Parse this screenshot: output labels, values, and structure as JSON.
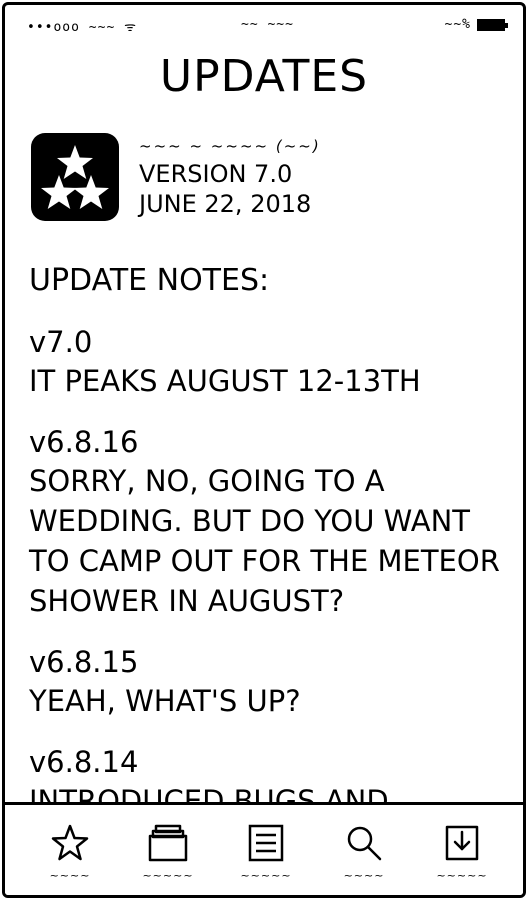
{
  "status_bar": {
    "carrier": "•••ooo ~~~ ᯤ",
    "time": "~~ ~~~",
    "battery_percent": "~~%"
  },
  "page": {
    "title": "UPDATES"
  },
  "app": {
    "name": "~~~ ~ ~~~~ (~~)",
    "version": "VERSION 7.0",
    "date": "JUNE 22, 2018",
    "icon": "three-stars-icon"
  },
  "notes": {
    "heading": "UPDATE NOTES:",
    "entries": [
      {
        "version": "v7.0",
        "text": "IT PEAKS AUGUST 12-13TH"
      },
      {
        "version": "v6.8.16",
        "text": "SORRY, NO, GOING TO A WEDDING. BUT DO YOU WANT TO CAMP OUT FOR THE METEOR SHOWER IN AUGUST?"
      },
      {
        "version": "v6.8.15",
        "text": "YEAH, WHAT'S UP?"
      },
      {
        "version": "v6.8.14",
        "text": "INTRODUCED BUGS AND DEGRADED PERFORMANCE"
      }
    ]
  },
  "tab_bar": {
    "items": [
      {
        "icon": "star-icon",
        "label": "~~~~"
      },
      {
        "icon": "stack-icon",
        "label": "~~~~~"
      },
      {
        "icon": "list-icon",
        "label": "~~~~~"
      },
      {
        "icon": "search-icon",
        "label": "~~~~"
      },
      {
        "icon": "download-icon",
        "label": "~~~~~"
      }
    ]
  }
}
